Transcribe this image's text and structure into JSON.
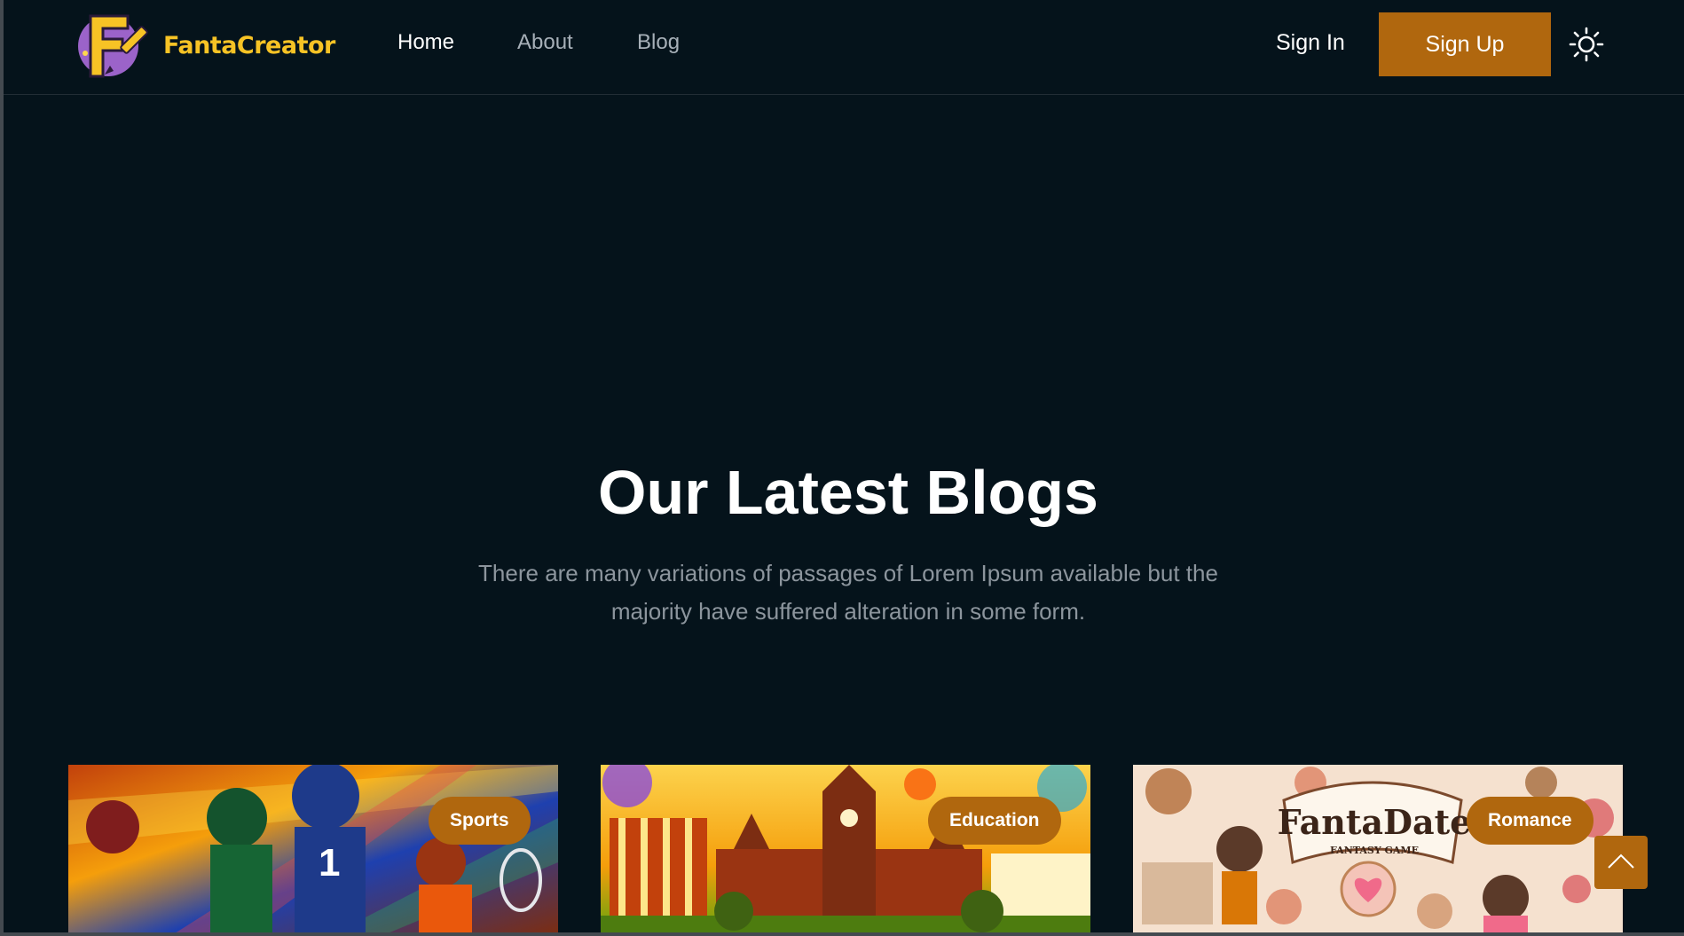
{
  "brand": {
    "name": "FantaCreator",
    "logo_letter": "F"
  },
  "nav": {
    "items": [
      {
        "label": "Home",
        "active": true
      },
      {
        "label": "About",
        "active": false
      },
      {
        "label": "Blog",
        "active": false
      }
    ]
  },
  "auth": {
    "signin_label": "Sign In",
    "signup_label": "Sign Up"
  },
  "theme_toggle": {
    "icon": "sun-icon"
  },
  "blogs_section": {
    "title": "Our Latest Blogs",
    "subtitle": "There are many variations of passages of Lorem Ipsum available but the majority have suffered alteration in some form."
  },
  "cards": [
    {
      "category": "Sports",
      "image": "sports-collage-image"
    },
    {
      "category": "Education",
      "image": "university-campus-image"
    },
    {
      "category": "Romance",
      "image": "fantadate-collage-image",
      "image_title": "FantaDate",
      "image_subtitle": "FANTASY GAME"
    }
  ],
  "scroll_top": {
    "icon": "chevron-up-icon"
  },
  "colors": {
    "background": "#05131b",
    "accent": "#b0670e",
    "brand_yellow": "#f7c325",
    "muted_text": "#8c959d"
  }
}
